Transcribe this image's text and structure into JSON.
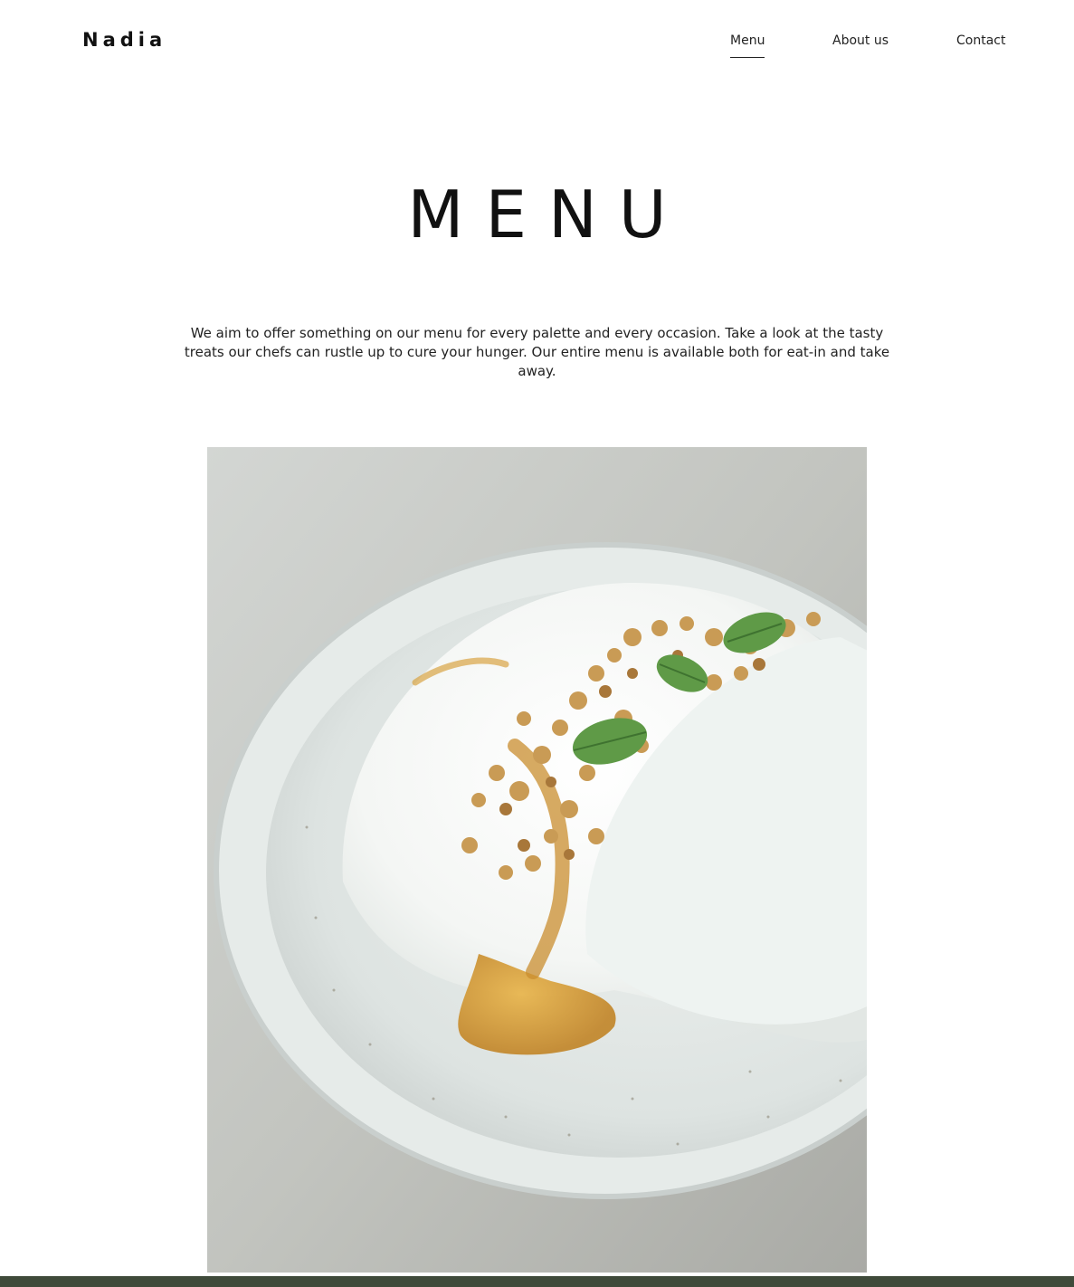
{
  "brand": {
    "name": "Nadia"
  },
  "nav": {
    "items": [
      {
        "label": "Menu",
        "active": true
      },
      {
        "label": "About us",
        "active": false
      },
      {
        "label": "Contact",
        "active": false
      }
    ]
  },
  "page": {
    "title": "MENU",
    "intro": "We aim to offer something on our menu for every palette and every occasion. Take a look at the tasty treats our chefs can rustle up to cure your hunger. Our entire menu is available both for eat-in and take away."
  },
  "colors": {
    "background": "#ffffff",
    "text": "#1a1a1a",
    "footer_accent": "#3f4a3a"
  }
}
